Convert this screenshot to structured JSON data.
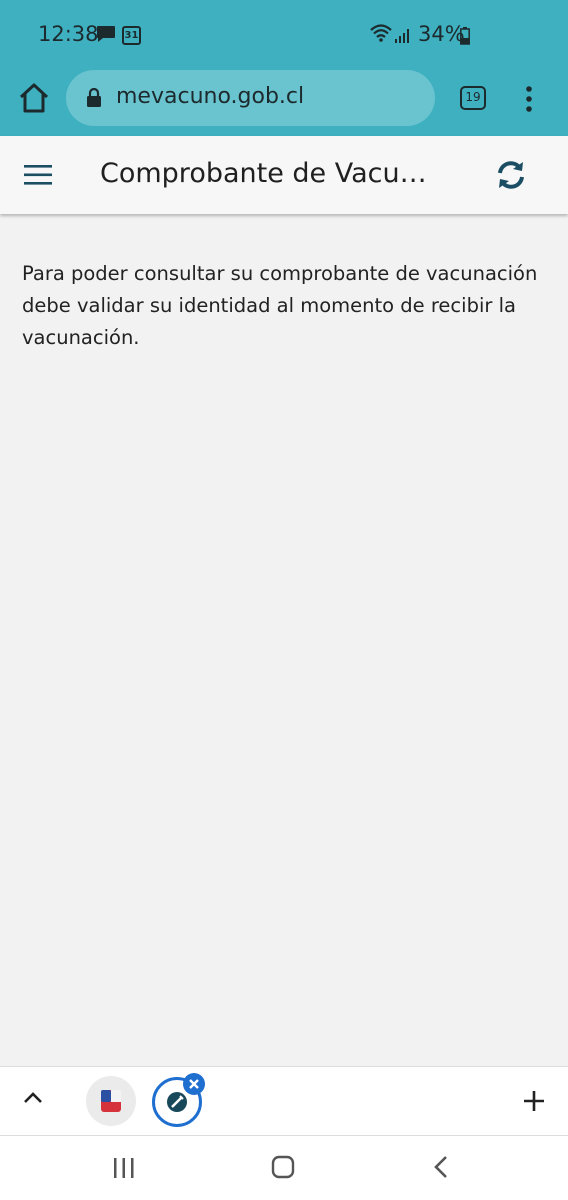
{
  "status_bar": {
    "time": "12:38",
    "calendar_day": "31",
    "battery_percent": "34%",
    "icons": [
      "message-icon",
      "calendar-icon",
      "wifi-icon",
      "signal-icon",
      "battery-icon"
    ]
  },
  "browser": {
    "url": "mevacuno.gob.cl",
    "tab_count": "19",
    "icons": [
      "home-icon",
      "lock-icon",
      "tabs-icon",
      "more-vert-icon"
    ]
  },
  "app_header": {
    "title": "Comprobante de Vacunación",
    "icons": [
      "hamburger-menu-icon",
      "refresh-icon"
    ],
    "accent_color": "#1b4e63"
  },
  "content": {
    "message": "Para poder consultar su comprobante de vacunación debe validar su identidad al momento de recibir la vacunación."
  },
  "tab_strip": {
    "icons": [
      "chevron-up-icon",
      "chile-flag-tab-icon",
      "vaccine-tab-icon",
      "close-tab-icon",
      "plus-icon"
    ],
    "active_color": "#1f6fd0"
  },
  "nav_bar": {
    "icons": [
      "recent-apps-icon",
      "home-nav-icon",
      "back-icon"
    ]
  },
  "colors": {
    "browser_bar": "#3fb0c0",
    "page_background": "#f2f2f2"
  }
}
